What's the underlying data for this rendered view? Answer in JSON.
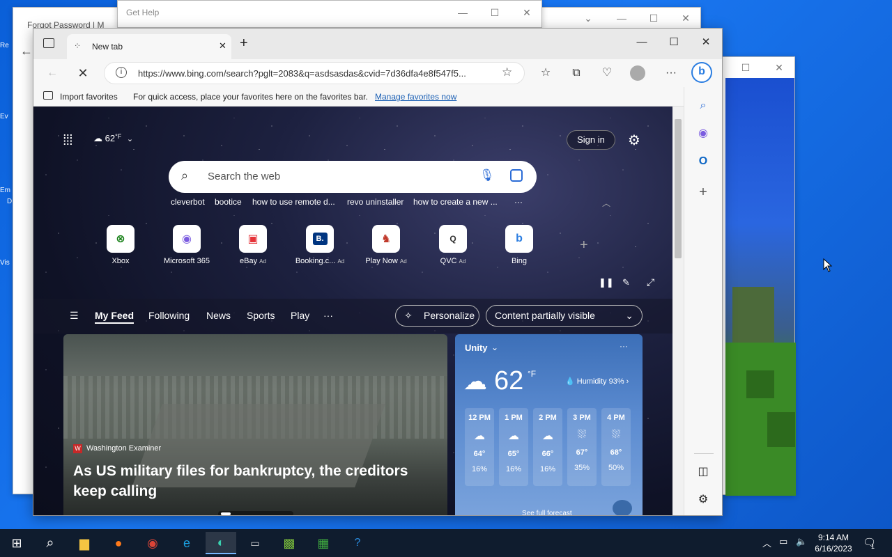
{
  "desktop": {
    "icons": [
      "Re",
      "Ev",
      "Em",
      "D",
      "Vis"
    ]
  },
  "bg_windows": {
    "forgot_title": "Forgot Password | M",
    "get_help_title": "Get Help"
  },
  "browser": {
    "tab_title": "New tab",
    "url": "https://www.bing.com/search?pglt=2083&q=asdsasdas&cvid=7d36dfa4e8f547f5...",
    "favbar": {
      "import_label": "Import favorites",
      "hint": "For quick access, place your favorites here on the favorites bar.",
      "manage_link": "Manage favorites now"
    }
  },
  "newtab": {
    "weather_temp": "62",
    "weather_unit": "°F",
    "sign_in": "Sign in",
    "search_placeholder": "Search the web",
    "suggestions": [
      "cleverbot",
      "bootice",
      "how to use remote d...",
      "revo uninstaller",
      "how to create a new ...",
      "···"
    ],
    "quick_links": [
      {
        "label": "Xbox",
        "ad": ""
      },
      {
        "label": "Microsoft 365",
        "ad": ""
      },
      {
        "label": "eBay",
        "ad": "Ad"
      },
      {
        "label": "Booking.c...",
        "ad": "Ad"
      },
      {
        "label": "Play Now",
        "ad": "Ad"
      },
      {
        "label": "QVC",
        "ad": "Ad"
      },
      {
        "label": "Bing",
        "ad": ""
      }
    ],
    "feed_tabs": [
      "My Feed",
      "Following",
      "News",
      "Sports",
      "Play",
      "···"
    ],
    "personalize": "Personalize",
    "content_visibility": "Content partially visible",
    "news": {
      "source": "Washington Examiner",
      "headline": "As US military files for bankruptcy, the creditors keep calling"
    },
    "weather_card": {
      "location": "Unity",
      "temp": "62",
      "unit": "°F",
      "humidity": "Humidity 93%",
      "hours": [
        {
          "time": "12 PM",
          "temp": "64°",
          "precip": "16%"
        },
        {
          "time": "1 PM",
          "temp": "65°",
          "precip": "16%"
        },
        {
          "time": "2 PM",
          "temp": "66°",
          "precip": "16%"
        },
        {
          "time": "3 PM",
          "temp": "67°",
          "precip": "35%"
        },
        {
          "time": "4 PM",
          "temp": "68°",
          "precip": "50%"
        }
      ],
      "forecast_link": "See full forecast"
    }
  },
  "taskbar": {
    "time": "9:14 AM",
    "date": "6/16/2023",
    "notification_count": "1"
  }
}
